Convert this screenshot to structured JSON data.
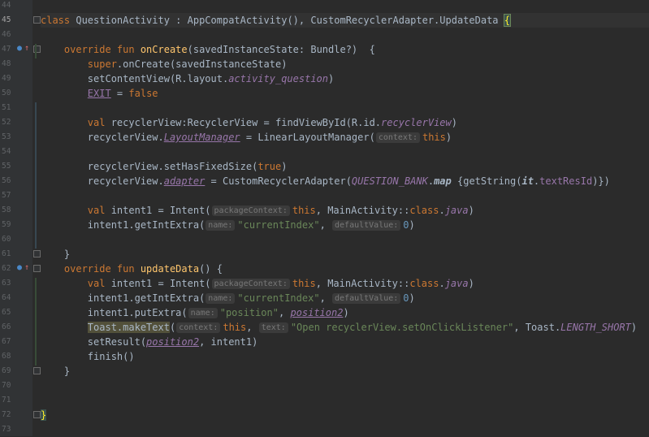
{
  "editor": {
    "language": "Kotlin",
    "current_line": 45,
    "lines": [
      {
        "n": "44",
        "html": ""
      },
      {
        "n": "45",
        "tokens": [
          {
            "t": "class ",
            "c": "kw"
          },
          {
            "t": "QuestionActivity : AppCompatActivity(), CustomRecyclerAdapter.UpdateData "
          },
          {
            "t": "{",
            "c": "brace-hl"
          }
        ]
      },
      {
        "n": "46",
        "tokens": []
      },
      {
        "n": "47",
        "tokens": [
          {
            "t": "    override fun ",
            "c": "kw"
          },
          {
            "t": "onCreate",
            "c": "fn"
          },
          {
            "t": "(savedInstanceState: Bundle?)  {"
          }
        ]
      },
      {
        "n": "48",
        "tokens": [
          {
            "t": "        "
          },
          {
            "t": "super",
            "c": "kw"
          },
          {
            "t": ".onCreate(savedInstanceState)"
          }
        ]
      },
      {
        "n": "49",
        "tokens": [
          {
            "t": "        setContentView(R.layout."
          },
          {
            "t": "activity_question",
            "c": "prop"
          },
          {
            "t": ")"
          }
        ]
      },
      {
        "n": "50",
        "tokens": [
          {
            "t": "        "
          },
          {
            "t": "EXIT",
            "c": "field u"
          },
          {
            "t": " = "
          },
          {
            "t": "false",
            "c": "kw"
          }
        ]
      },
      {
        "n": "51",
        "tokens": []
      },
      {
        "n": "52",
        "tokens": [
          {
            "t": "        "
          },
          {
            "t": "val ",
            "c": "kw"
          },
          {
            "t": "recyclerView:RecyclerView = findViewById(R.id."
          },
          {
            "t": "recyclerView",
            "c": "prop"
          },
          {
            "t": ")"
          }
        ]
      },
      {
        "n": "53",
        "tokens": [
          {
            "t": "        recyclerView."
          },
          {
            "t": "LayoutManager",
            "c": "prop u"
          },
          {
            "t": " = LinearLayoutManager("
          },
          {
            "hint": "context:"
          },
          {
            "t": "this",
            "c": "kw"
          },
          {
            "t": ")"
          }
        ]
      },
      {
        "n": "54",
        "tokens": []
      },
      {
        "n": "55",
        "tokens": [
          {
            "t": "        recyclerView.setHasFixedSize("
          },
          {
            "t": "true",
            "c": "kw"
          },
          {
            "t": ")"
          }
        ]
      },
      {
        "n": "56",
        "tokens": [
          {
            "t": "        recyclerView."
          },
          {
            "t": "adapter",
            "c": "prop u"
          },
          {
            "t": " = CustomRecyclerAdapter("
          },
          {
            "t": "QUESTION_BANK",
            "c": "prop"
          },
          {
            "t": "."
          },
          {
            "t": "map",
            "c": "boldital"
          },
          {
            "t": " {getString("
          },
          {
            "t": "it",
            "c": "boldital"
          },
          {
            "t": "."
          },
          {
            "t": "textResId",
            "c": "field"
          },
          {
            "t": ")})"
          }
        ]
      },
      {
        "n": "57",
        "tokens": []
      },
      {
        "n": "58",
        "tokens": [
          {
            "t": "        "
          },
          {
            "t": "val ",
            "c": "kw"
          },
          {
            "t": "intent1 = Intent("
          },
          {
            "hint": "packageContext:"
          },
          {
            "t": "this",
            "c": "kw"
          },
          {
            "t": ", MainActivity::"
          },
          {
            "t": "class",
            "c": "kw"
          },
          {
            "t": "."
          },
          {
            "t": "java",
            "c": "prop"
          },
          {
            "t": ")"
          }
        ]
      },
      {
        "n": "59",
        "tokens": [
          {
            "t": "        intent1.getIntExtra("
          },
          {
            "hint": "name:"
          },
          {
            "t": "\"currentIndex\"",
            "c": "str"
          },
          {
            "t": ", "
          },
          {
            "hint": "defaultValue:"
          },
          {
            "t": "0",
            "c": "num"
          },
          {
            "t": ")"
          }
        ]
      },
      {
        "n": "60",
        "tokens": []
      },
      {
        "n": "61",
        "tokens": [
          {
            "t": "    }"
          }
        ]
      },
      {
        "n": "62",
        "tokens": [
          {
            "t": "    override fun ",
            "c": "kw"
          },
          {
            "t": "updateData",
            "c": "fn"
          },
          {
            "t": "() {"
          }
        ]
      },
      {
        "n": "63",
        "tokens": [
          {
            "t": "        "
          },
          {
            "t": "val ",
            "c": "kw"
          },
          {
            "t": "intent1 = Intent("
          },
          {
            "hint": "packageContext:"
          },
          {
            "t": "this",
            "c": "kw"
          },
          {
            "t": ", MainActivity::"
          },
          {
            "t": "class",
            "c": "kw"
          },
          {
            "t": "."
          },
          {
            "t": "java",
            "c": "prop"
          },
          {
            "t": ")"
          }
        ]
      },
      {
        "n": "64",
        "tokens": [
          {
            "t": "        intent1.getIntExtra("
          },
          {
            "hint": "name:"
          },
          {
            "t": "\"currentIndex\"",
            "c": "str"
          },
          {
            "t": ", "
          },
          {
            "hint": "defaultValue:"
          },
          {
            "t": "0",
            "c": "num"
          },
          {
            "t": ")"
          }
        ]
      },
      {
        "n": "65",
        "tokens": [
          {
            "t": "        intent1.putExtra("
          },
          {
            "hint": "name:"
          },
          {
            "t": "\"position\"",
            "c": "str"
          },
          {
            "t": ", "
          },
          {
            "t": "position2",
            "c": "prop u"
          },
          {
            "t": ")"
          }
        ]
      },
      {
        "n": "66",
        "tokens": [
          {
            "t": "        "
          },
          {
            "t": "Toast.makeText",
            "c": "toast-hl"
          },
          {
            "t": "("
          },
          {
            "hint": "context:"
          },
          {
            "t": "this",
            "c": "kw"
          },
          {
            "t": ", "
          },
          {
            "hint": "text:"
          },
          {
            "t": "\"Open recyclerView.setOnClickListener\"",
            "c": "str"
          },
          {
            "t": ", Toast."
          },
          {
            "t": "LENGTH_SHORT",
            "c": "prop"
          },
          {
            "t": ")"
          }
        ]
      },
      {
        "n": "67",
        "tokens": [
          {
            "t": "        setResult("
          },
          {
            "t": "position2",
            "c": "prop u"
          },
          {
            "t": ", intent1)"
          }
        ]
      },
      {
        "n": "68",
        "tokens": [
          {
            "t": "        finish()"
          }
        ]
      },
      {
        "n": "69",
        "tokens": [
          {
            "t": "    }"
          }
        ]
      },
      {
        "n": "70",
        "tokens": []
      },
      {
        "n": "71",
        "tokens": []
      },
      {
        "n": "72",
        "tokens": [
          {
            "t": "}",
            "c": "brace-match"
          }
        ]
      },
      {
        "n": "73",
        "tokens": []
      }
    ]
  },
  "icons": {
    "override_icon": "override-icon",
    "implements_icon": "implements-up-icon",
    "fold_icon": "fold-icon"
  }
}
